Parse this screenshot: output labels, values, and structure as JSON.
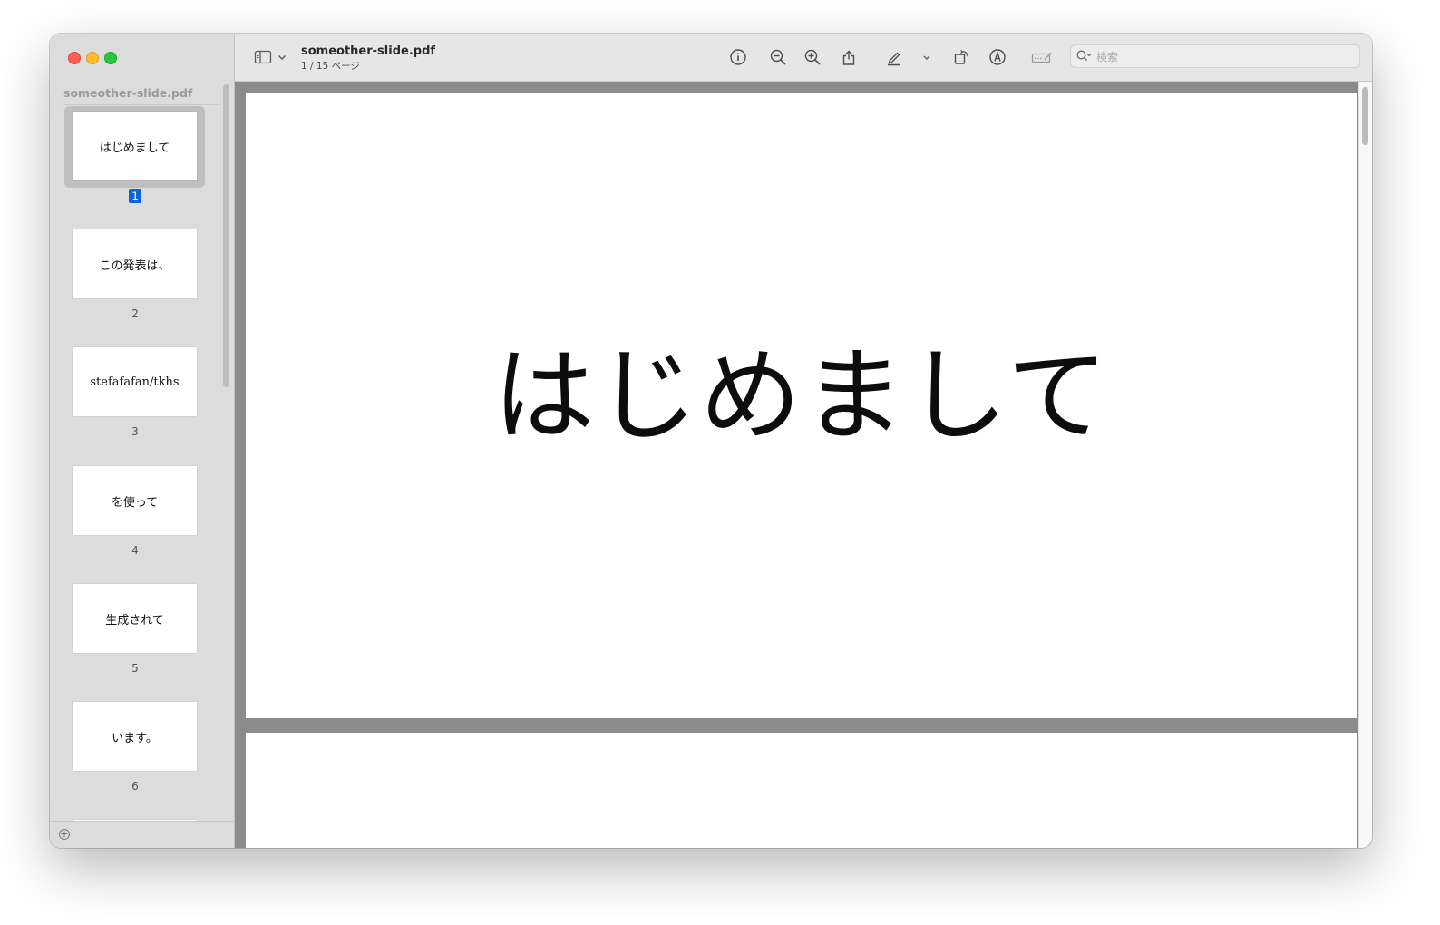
{
  "window": {
    "traffic_lights": [
      "close",
      "minimize",
      "zoom"
    ]
  },
  "sidebar": {
    "title": "someother-slide.pdf",
    "thumbnails": [
      {
        "text": "はじめまして",
        "number": "1",
        "selected": true
      },
      {
        "text": "この発表は、",
        "number": "2",
        "selected": false
      },
      {
        "text": "stefafafan/tkhs",
        "number": "3",
        "selected": false
      },
      {
        "text": "を使って",
        "number": "4",
        "selected": false
      },
      {
        "text": "生成されて",
        "number": "5",
        "selected": false
      },
      {
        "text": "います。",
        "number": "6",
        "selected": false
      }
    ]
  },
  "toolbar": {
    "doc_title": "someother-slide.pdf",
    "page_indicator": "1 / 15 ページ",
    "search_placeholder": "検索",
    "icons": [
      "sidebar-toggle-icon",
      "chevron-down-icon",
      "info-icon",
      "zoom-out-icon",
      "zoom-in-icon",
      "share-icon",
      "highlight-pen-icon",
      "chevron-down-icon",
      "rotate-icon",
      "markup-icon",
      "form-fill-icon",
      "search-icon"
    ]
  },
  "document": {
    "current_page_text": "はじめまして"
  },
  "colors": {
    "selection": "#0b64d6",
    "sidebar_bg": "#dcdcdc",
    "toolbar_bg": "#e6e6e6",
    "viewer_bg": "#8b8b8b"
  }
}
